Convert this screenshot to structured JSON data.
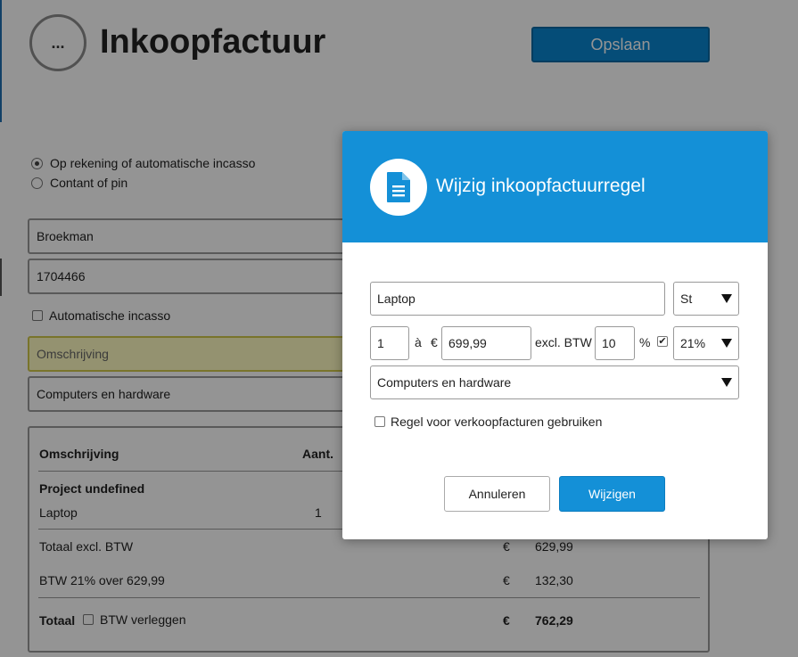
{
  "page": {
    "menu_label": "...",
    "title": "Inkoopfactuur",
    "save_label": "Opslaan",
    "payment_options": [
      {
        "label": "Op rekening of automatische incasso",
        "selected": true
      },
      {
        "label": "Contant of pin",
        "selected": false
      }
    ],
    "supplier_value": "Broekman",
    "number_value": "1704466",
    "auto_incasso_label": "Automatische incasso",
    "omschrijving_placeholder": "Omschrijving",
    "category_value": "Computers en hardware",
    "table": {
      "header_desc": "Omschrijving",
      "header_qty": "Aant.",
      "project_label": "Project undefined",
      "row_desc": "Laptop",
      "row_qty": "1",
      "total_excl_label": "Totaal excl. BTW",
      "total_excl_currency": "€",
      "total_excl_value": "629,99",
      "btw_label": "BTW 21% over 629,99",
      "btw_currency": "€",
      "btw_value": "132,30",
      "total_label": "Totaal",
      "btw_verleggen_label": "BTW verleggen",
      "total_currency": "€",
      "total_value": "762,29"
    }
  },
  "modal": {
    "title": "Wijzig inkoopfactuurregel",
    "icon": "document-icon",
    "description_value": "Laptop",
    "unit_value": "St",
    "quantity_value": "1",
    "a_label": "à",
    "currency_label": "€",
    "price_value": "699,99",
    "excl_btw_label": "excl. BTW",
    "discount_value": "10",
    "percent_label": "%",
    "vat_checked": true,
    "vat_value": "21%",
    "category_value": "Computers en hardware",
    "use_rule_label": "Regel voor verkoopfacturen gebruiken",
    "use_rule_checked": false,
    "cancel_label": "Annuleren",
    "submit_label": "Wijzigen"
  },
  "colors": {
    "brand_blue": "#1490d7",
    "overlay": "rgba(0,0,0,0.42)",
    "highlight_field": "#fffcc2"
  }
}
